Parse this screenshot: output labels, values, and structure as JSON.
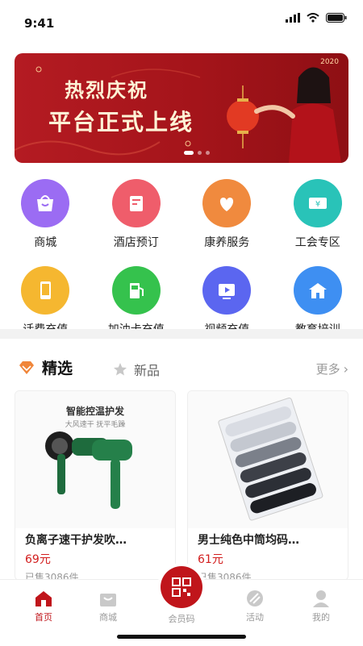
{
  "status_bar": {
    "time": "9:41"
  },
  "banner": {
    "line1": "热烈庆祝",
    "line2": "平台正式上线",
    "year": "2020"
  },
  "categories": [
    {
      "label": "商城",
      "icon": "shop-icon",
      "color": "#9b6cf3"
    },
    {
      "label": "酒店预订",
      "icon": "hotel-icon",
      "color": "#ef5d6b"
    },
    {
      "label": "康养服务",
      "icon": "heart-icon",
      "color": "#f08a3e"
    },
    {
      "label": "工会专区",
      "icon": "ticket-icon",
      "color": "#29c3b8"
    },
    {
      "label": "话费充值",
      "icon": "phone-icon",
      "color": "#f5b730"
    },
    {
      "label": "加油卡充值",
      "icon": "fuel-icon",
      "color": "#35c24d"
    },
    {
      "label": "视频充值",
      "icon": "video-icon",
      "color": "#5b66f0"
    },
    {
      "label": "教育培训",
      "icon": "school-icon",
      "color": "#3e8ff2"
    }
  ],
  "section": {
    "tab_selected": "精选",
    "tab_other": "新品",
    "more_label": "更多"
  },
  "products": [
    {
      "name": "负离子速干护发吹…",
      "price": "69元",
      "sold": "已售3086件",
      "image_caption": "智能控温护发",
      "image_subcaption": "大风速干  抚平毛躁"
    },
    {
      "name": "男士纯色中筒均码…",
      "price": "61元",
      "sold": "已售3086件"
    }
  ],
  "bottom_nav": [
    {
      "label": "首页",
      "icon": "home-icon",
      "active": true
    },
    {
      "label": "商城",
      "icon": "store-icon",
      "active": false
    },
    {
      "label": "会员码",
      "icon": "qr-code-icon",
      "active": false
    },
    {
      "label": "活动",
      "icon": "activity-icon",
      "active": false
    },
    {
      "label": "我的",
      "icon": "profile-icon",
      "active": false
    }
  ],
  "colors": {
    "brand_red": "#c0151b",
    "price_red": "#d21d1d"
  }
}
